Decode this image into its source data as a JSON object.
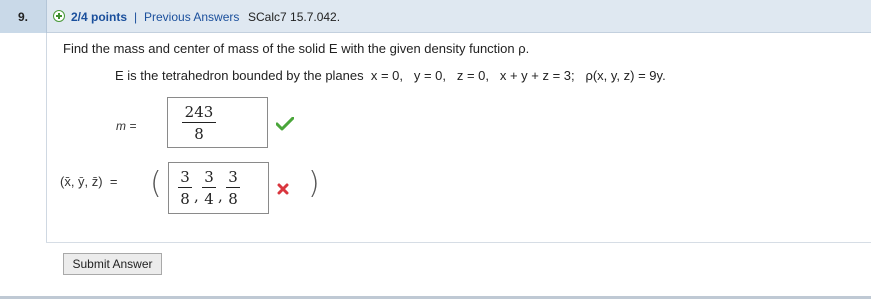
{
  "question": {
    "number": "9.",
    "points": "2/4 points",
    "separator": "|",
    "previous_answers_label": "Previous Answers",
    "code": "SCalc7 15.7.042."
  },
  "problem": {
    "prompt": "Find the mass and center of mass of the solid E with the given density function ρ.",
    "given": "E is the tetrahedron bounded by the planes  x = 0,   y = 0,   z = 0,   x + y + z = 3;   ρ(x, y, z) = 9y."
  },
  "mass": {
    "label": "m =",
    "numerator": "243",
    "denominator": "8",
    "status": "correct"
  },
  "center_of_mass": {
    "label": "(x̄, ȳ, z̄)  =",
    "open_paren": "(",
    "close_paren": ")",
    "fractions": [
      {
        "numerator": "3",
        "denominator": "8"
      },
      {
        "numerator": "3",
        "denominator": "4"
      },
      {
        "numerator": "3",
        "denominator": "8"
      }
    ],
    "comma": ",",
    "status": "incorrect"
  },
  "submit": {
    "label": "Submit Answer"
  },
  "colors": {
    "header_bg": "#dfe8f1",
    "link": "#1a4f9c",
    "correct": "#4aa63a",
    "incorrect": "#d9363e"
  }
}
